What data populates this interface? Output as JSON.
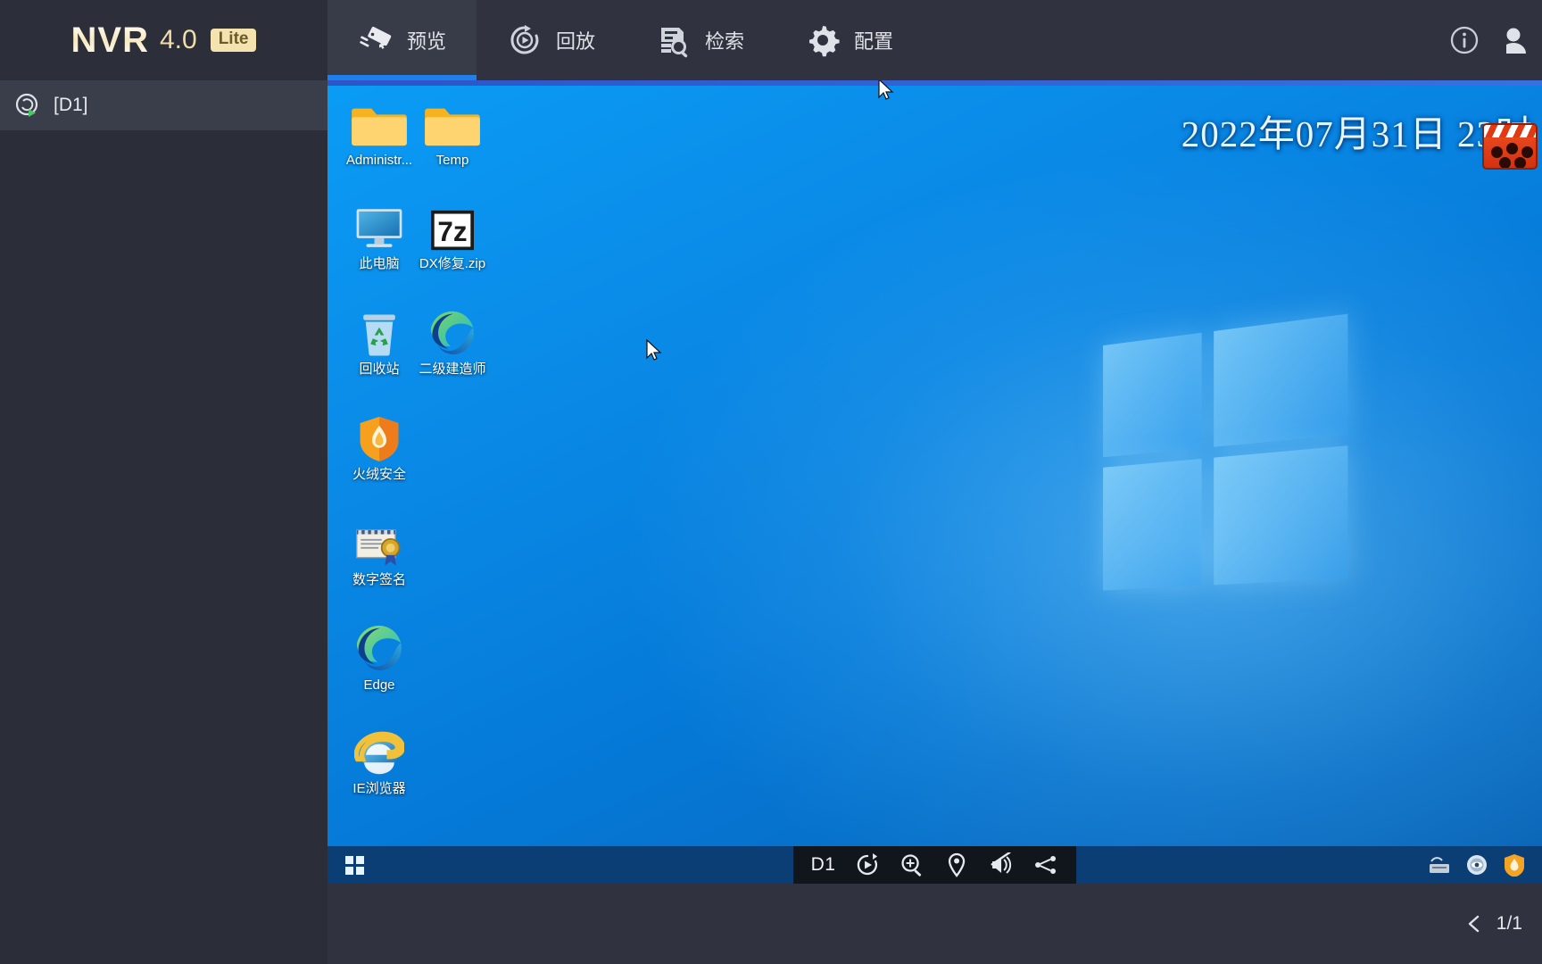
{
  "app": {
    "brand_name": "NVR",
    "brand_version": "4.0",
    "brand_edition": "Lite"
  },
  "topbar": {
    "tabs": [
      {
        "label": "预览",
        "icon": "camera-icon",
        "active": true
      },
      {
        "label": "回放",
        "icon": "playback-icon",
        "active": false
      },
      {
        "label": "检索",
        "icon": "search-doc-icon",
        "active": false
      },
      {
        "label": "配置",
        "icon": "gear-icon",
        "active": false
      }
    ],
    "info_icon": "info-icon",
    "user_icon": "user-icon"
  },
  "sidebar": {
    "items": [
      {
        "label": "[D1]",
        "icon": "channel-play-icon"
      }
    ]
  },
  "video": {
    "osd_datetime": "2022年07月31日 23时",
    "channel_label": "D1",
    "controls": [
      {
        "name": "instant-playback-icon",
        "title": "回放"
      },
      {
        "name": "digital-zoom-icon",
        "title": "电子放大"
      },
      {
        "name": "target-track-icon",
        "title": "目标"
      },
      {
        "name": "audio-mute-icon",
        "title": "静音"
      },
      {
        "name": "stream-switch-icon",
        "title": "码流切换"
      }
    ],
    "desktop_icons": [
      {
        "label": "Administr...",
        "icon": "folder-icon",
        "col": 0,
        "row": 0
      },
      {
        "label": "Temp",
        "icon": "folder-icon",
        "col": 1,
        "row": 0
      },
      {
        "label": "此电脑",
        "icon": "this-pc-icon",
        "col": 0,
        "row": 1
      },
      {
        "label": "DX修复.zip",
        "icon": "sevenzip-icon",
        "col": 1,
        "row": 1
      },
      {
        "label": "回收站",
        "icon": "recycle-bin-icon",
        "col": 0,
        "row": 2
      },
      {
        "label": "二级建造师",
        "icon": "edge-icon",
        "col": 1,
        "row": 2
      },
      {
        "label": "火绒安全",
        "icon": "huorong-shield-icon",
        "col": 0,
        "row": 3
      },
      {
        "label": "数字签名",
        "icon": "certificate-icon",
        "col": 0,
        "row": 4
      },
      {
        "label": "Edge",
        "icon": "edge-icon",
        "col": 0,
        "row": 5
      },
      {
        "label": "IE浏览器",
        "icon": "ie-icon",
        "col": 0,
        "row": 6
      }
    ],
    "taskbar": {
      "start_icon": "windows-start-icon",
      "tray": [
        {
          "name": "scanner-icon"
        },
        {
          "name": "eye-disc-icon"
        },
        {
          "name": "huorong-shield-icon"
        }
      ]
    }
  },
  "bottombar": {
    "prev_icon": "chevron-left-icon",
    "page_text": "1/1"
  },
  "colors": {
    "chrome_dark": "#30333f",
    "sidebar": "#2b2e38",
    "accent_blue": "#1f7fec",
    "desktop_blue": "#0a86e8",
    "brand_gold": "#f0dda8"
  }
}
